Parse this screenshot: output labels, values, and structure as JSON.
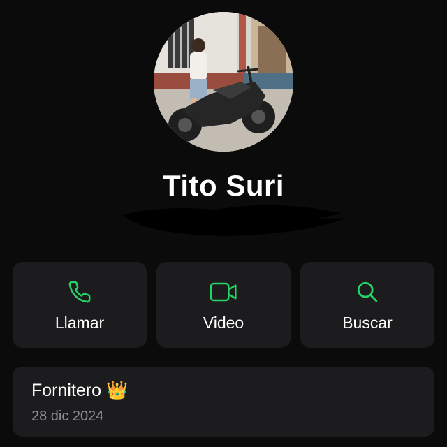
{
  "contact": {
    "name": "Tito Suri",
    "avatar_icon": "profile-photo-motorcycle",
    "subtitle_redacted": true
  },
  "actions": [
    {
      "label": "Llamar",
      "icon": "phone-icon"
    },
    {
      "label": "Video",
      "icon": "video-camera-icon"
    },
    {
      "label": "Buscar",
      "icon": "search-icon"
    }
  ],
  "about": {
    "text": "Fornitero 👑",
    "date": "28 dic 2024"
  },
  "colors": {
    "background": "#0b0b0b",
    "card": "#1c1c1e",
    "accent": "#25d366",
    "secondary_text": "#8e8e93"
  }
}
